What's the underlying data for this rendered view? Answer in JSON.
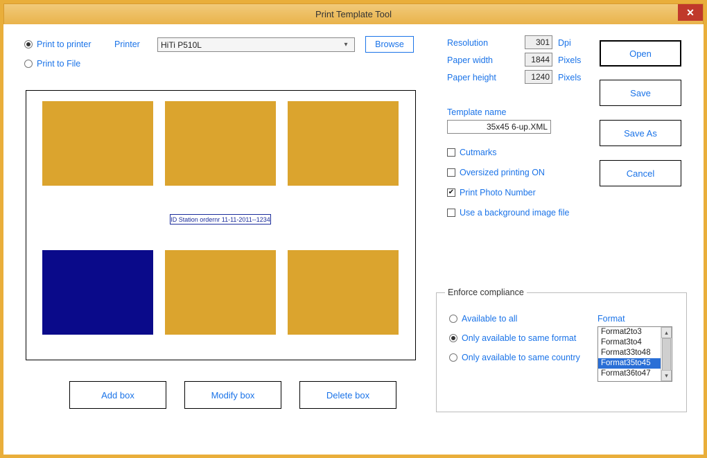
{
  "window": {
    "title": "Print Template Tool"
  },
  "printTarget": {
    "toPrinterLabel": "Print to printer",
    "toFileLabel": "Print to File",
    "selected": "printer"
  },
  "printer": {
    "label": "Printer",
    "value": "HiTi P510L",
    "browseLabel": "Browse"
  },
  "paper": {
    "resolutionLabel": "Resolution",
    "resolutionValue": "301",
    "resolutionUnit": "Dpi",
    "widthLabel": "Paper width",
    "widthValue": "1844",
    "widthUnit": "Pixels",
    "heightLabel": "Paper height",
    "heightValue": "1240",
    "heightUnit": "Pixels"
  },
  "actions": {
    "open": "Open",
    "save": "Save",
    "saveAs": "Save As",
    "cancel": "Cancel"
  },
  "template": {
    "nameLabel": "Template name",
    "nameValue": "35x45 6-up.XML"
  },
  "options": {
    "cutmarks": {
      "label": "Cutmarks",
      "checked": false
    },
    "oversized": {
      "label": "Oversized printing ON",
      "checked": false
    },
    "printPhotoNumber": {
      "label": "Print Photo Number",
      "checked": true
    },
    "useBgImage": {
      "label": "Use a background image file",
      "checked": false
    }
  },
  "preview": {
    "idStationLabel": "ID Station ordernr 11-11-2011--1234",
    "selectedBoxIndex": 3,
    "boxCount": 6
  },
  "bottomActions": {
    "addBox": "Add box",
    "modifyBox": "Modify box",
    "deleteBox": "Delete box"
  },
  "enforce": {
    "legend": "Enforce compliance",
    "optAll": "Available to all",
    "optSameFormat": "Only available to same format",
    "optSameCountry": "Only available to same country",
    "selected": "sameFormat",
    "formatLabel": "Format",
    "formats": [
      "Format2to3",
      "Format3to4",
      "Format33to48",
      "Format35to45",
      "Format36to47"
    ],
    "formatSelected": "Format35to45"
  }
}
